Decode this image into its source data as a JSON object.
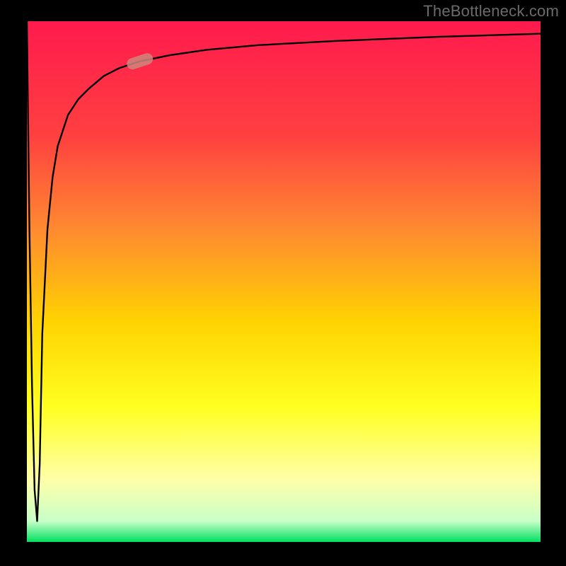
{
  "watermark": "TheBottleneck.com",
  "colors": {
    "frame": "#000000",
    "grad_top": "#ff1a4d",
    "grad_mid_upper": "#ff6a3a",
    "grad_mid": "#ffd400",
    "grad_mid_lower": "#ffff20",
    "grad_pale": "#ffffa8",
    "grad_bottom": "#00e060",
    "curve": "#000000",
    "marker_fill": "#cf867e",
    "marker_stroke": "#8a4f48"
  },
  "chart_data": {
    "type": "line",
    "title": "",
    "xlabel": "",
    "ylabel": "",
    "xlim": [
      0,
      100
    ],
    "ylim": [
      0,
      100
    ],
    "grid": false,
    "legend": false,
    "annotations": [
      "TheBottleneck.com"
    ],
    "series": [
      {
        "name": "bottleneck-curve",
        "x": [
          0,
          0.5,
          1,
          1.5,
          2,
          2.5,
          3,
          4,
          5,
          6,
          8,
          10,
          12,
          15,
          18,
          22,
          28,
          35,
          45,
          60,
          80,
          100
        ],
        "y": [
          100,
          60,
          30,
          10,
          4,
          15,
          40,
          60,
          70,
          76,
          82,
          85,
          87,
          89.5,
          91,
          92.3,
          93.5,
          94.5,
          95.4,
          96.2,
          97,
          97.6
        ]
      }
    ],
    "marker": {
      "x_fraction": 0.22,
      "y_fraction": 0.905
    }
  }
}
